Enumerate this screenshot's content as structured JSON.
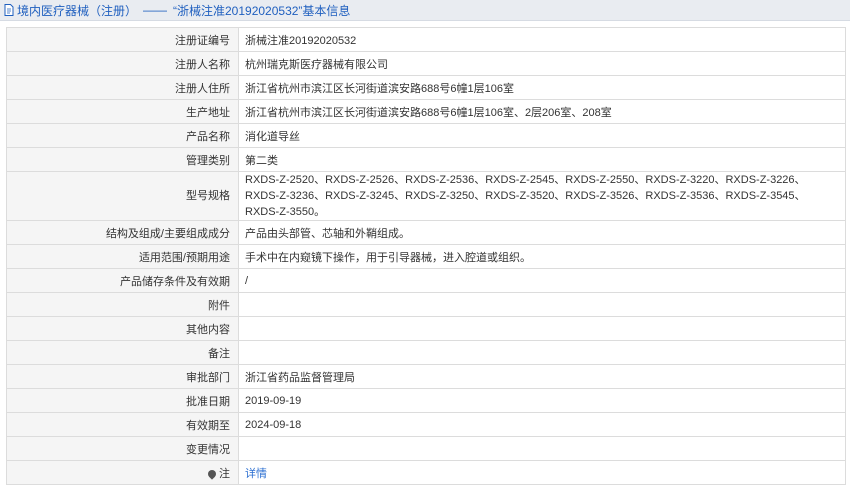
{
  "header": {
    "breadcrumb": "境内医疗器械（注册）",
    "separator": "——",
    "title": "“浙械注准20192020532”基本信息"
  },
  "rows": [
    {
      "label": "注册证编号",
      "value": "浙械注准20192020532"
    },
    {
      "label": "注册人名称",
      "value": "杭州瑞克斯医疗器械有限公司"
    },
    {
      "label": "注册人住所",
      "value": "浙江省杭州市滨江区长河街道滨安路688号6幢1层106室"
    },
    {
      "label": "生产地址",
      "value": "浙江省杭州市滨江区长河街道滨安路688号6幢1层106室、2层206室、208室"
    },
    {
      "label": "产品名称",
      "value": "消化道导丝"
    },
    {
      "label": "管理类别",
      "value": "第二类"
    },
    {
      "label": "型号规格",
      "value": "RXDS-Z-2520、RXDS-Z-2526、RXDS-Z-2536、RXDS-Z-2545、RXDS-Z-2550、RXDS-Z-3220、RXDS-Z-3226、RXDS-Z-3236、RXDS-Z-3245、RXDS-Z-3250、RXDS-Z-3520、RXDS-Z-3526、RXDS-Z-3536、RXDS-Z-3545、RXDS-Z-3550。"
    },
    {
      "label": "结构及组成/主要组成成分",
      "value": "产品由头部管、芯轴和外鞘组成。"
    },
    {
      "label": "适用范围/预期用途",
      "value": "手术中在内窥镜下操作，用于引导器械，进入腔道或组织。"
    },
    {
      "label": "产品储存条件及有效期",
      "value": "/"
    },
    {
      "label": "附件",
      "value": ""
    },
    {
      "label": "其他内容",
      "value": ""
    },
    {
      "label": "备注",
      "value": ""
    },
    {
      "label": "审批部门",
      "value": "浙江省药品监督管理局"
    },
    {
      "label": "批准日期",
      "value": "2019-09-19"
    },
    {
      "label": "有效期至",
      "value": "2024-09-18"
    },
    {
      "label": "变更情况",
      "value": ""
    },
    {
      "label": "注",
      "value": "详情"
    }
  ],
  "icons": {
    "title": "document-icon",
    "note": "pin-icon"
  }
}
